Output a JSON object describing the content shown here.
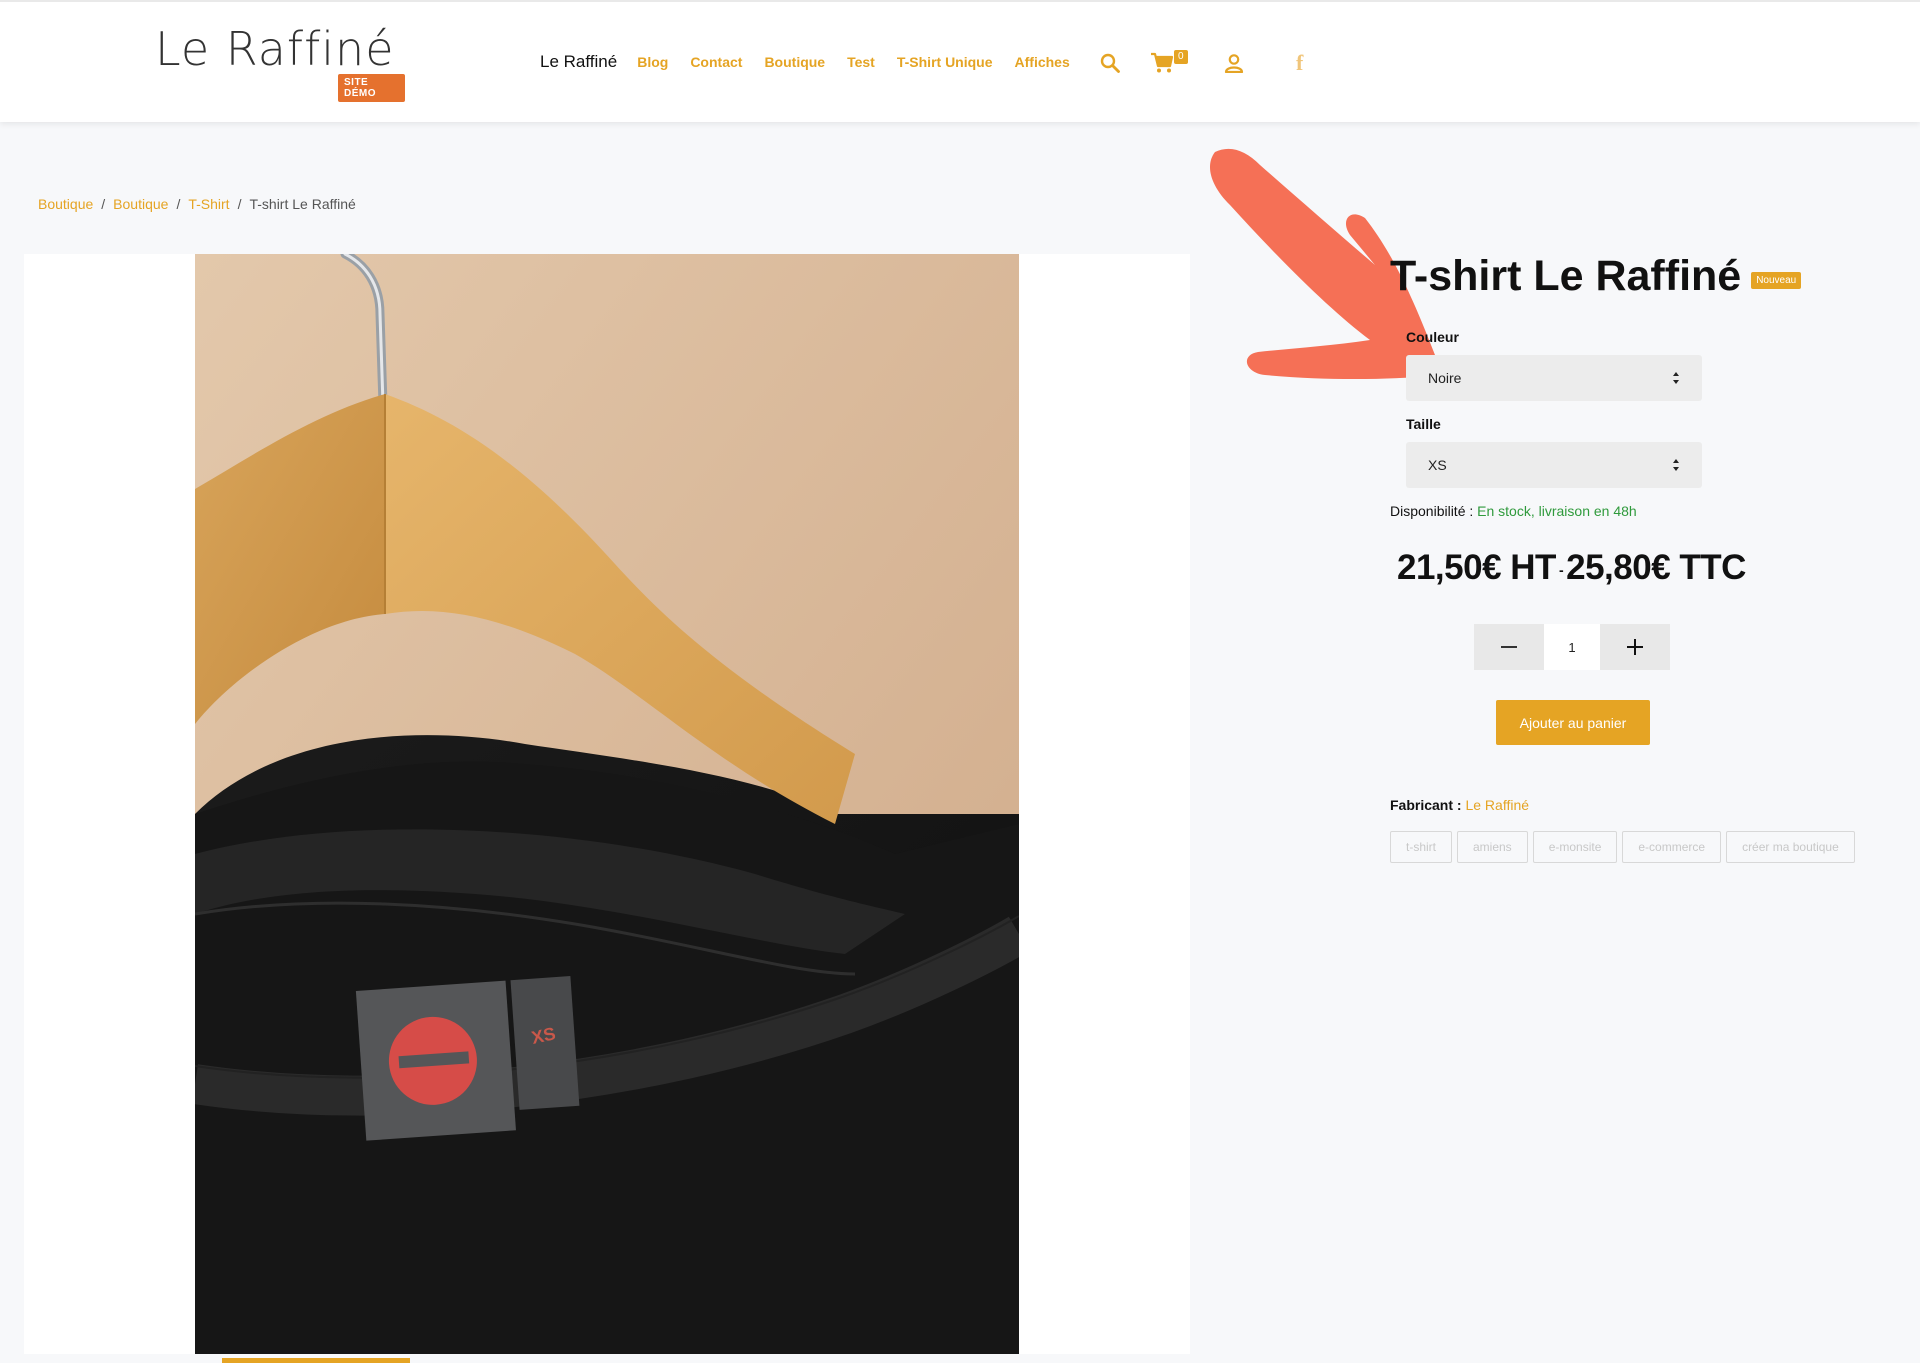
{
  "header": {
    "logo_text": "Le Raffiné",
    "logo_badge": "SITE DÉMO",
    "nav_home": "Le Raffiné",
    "nav_links": [
      "Blog",
      "Contact",
      "Boutique",
      "Test",
      "T-Shirt Unique",
      "Affiches"
    ],
    "cart_count": "0",
    "facebook_glyph": "f"
  },
  "breadcrumb": {
    "items": [
      "Boutique",
      "Boutique",
      "T-Shirt"
    ],
    "current": "T-shirt Le Raffiné"
  },
  "product": {
    "title": "T-shirt Le Raffiné",
    "badge": "Nouveau",
    "color_label": "Couleur",
    "color_value": "Noire",
    "size_label": "Taille",
    "size_value": "XS",
    "availability_label": "Disponibilité :",
    "availability_value": "En stock, livraison en 48h",
    "price_ht": "21,50€ HT",
    "price_sep": "-",
    "price_ttc": "25,80€ TTC",
    "quantity": "1",
    "add_to_cart": "Ajouter au panier",
    "maker_label": "Fabricant :",
    "maker_value": "Le Raffiné",
    "tags": [
      "t-shirt",
      "amiens",
      "e-monsite",
      "e-commerce",
      "créer ma boutique"
    ],
    "photo_label_size": "XS",
    "photo_label_logo": "e"
  },
  "colors": {
    "accent": "#e5a424",
    "logo_badge": "#e5712e",
    "arrow": "#f57056",
    "in_stock": "#2f9a3c"
  }
}
